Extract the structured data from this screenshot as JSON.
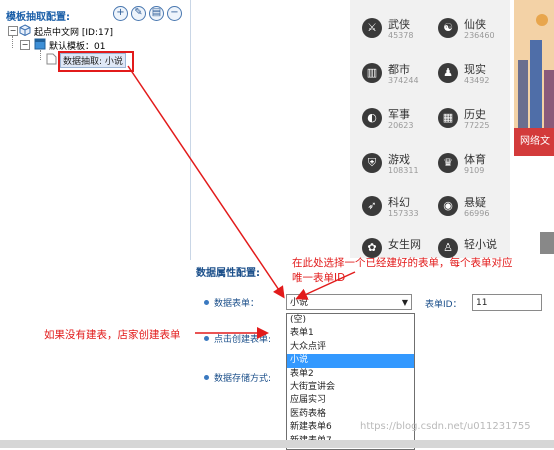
{
  "left_panel": {
    "title": "模板抽取配置:",
    "toolbar": [
      "+",
      "✎",
      "▤",
      "−"
    ],
    "tree": {
      "root_label": "起点中文网 [ID:17]",
      "child_label": "默认模板：01",
      "leaf_label": "数据抽取: 小说"
    }
  },
  "categories": [
    {
      "name": "武侠",
      "count": "45378",
      "icon": "sword-icon"
    },
    {
      "name": "仙侠",
      "count": "236460",
      "icon": "yin-yang-icon"
    },
    {
      "name": "都市",
      "count": "374244",
      "icon": "city-icon"
    },
    {
      "name": "现实",
      "count": "43492",
      "icon": "person-icon"
    },
    {
      "name": "军事",
      "count": "20623",
      "icon": "helmet-icon"
    },
    {
      "name": "历史",
      "count": "77225",
      "icon": "building-icon"
    },
    {
      "name": "游戏",
      "count": "108311",
      "icon": "shield-icon"
    },
    {
      "name": "体育",
      "count": "9109",
      "icon": "trophy-icon"
    },
    {
      "name": "科幻",
      "count": "157333",
      "icon": "rocket-icon"
    },
    {
      "name": "悬疑",
      "count": "66996",
      "icon": "eye-icon"
    },
    {
      "name": "女生网",
      "count": "",
      "icon": "flower-icon"
    },
    {
      "name": "轻小说",
      "count": "",
      "icon": "figure-icon"
    }
  ],
  "banner": {
    "label": "网络文"
  },
  "attributes": {
    "title": "数据属性配置:",
    "table_label": "数据表单：",
    "create_label": "点击创建表单:",
    "storage_label": "数据存储方式:",
    "selected_value": "小说",
    "options": [
      "(空)",
      "表单1",
      "大众点评",
      "小说",
      "表单2",
      "大街宣讲会",
      "应届实习",
      "医药表格",
      "新建表单6",
      "新建表单7"
    ],
    "selected_index": 3,
    "table_id_label": "表单ID：",
    "table_id_value": "11"
  },
  "annotations": {
    "top": "在此处选择一个已经建好的表单，每个表单对应",
    "top_line2": "唯一表单ID",
    "left": "如果没有建表，店家创建表单"
  },
  "watermark": "https://blog.csdn.net/u011231755",
  "colors": {
    "annotation": "#e21b1b",
    "selection": "#3399ff",
    "accent": "#1b4f8a"
  }
}
